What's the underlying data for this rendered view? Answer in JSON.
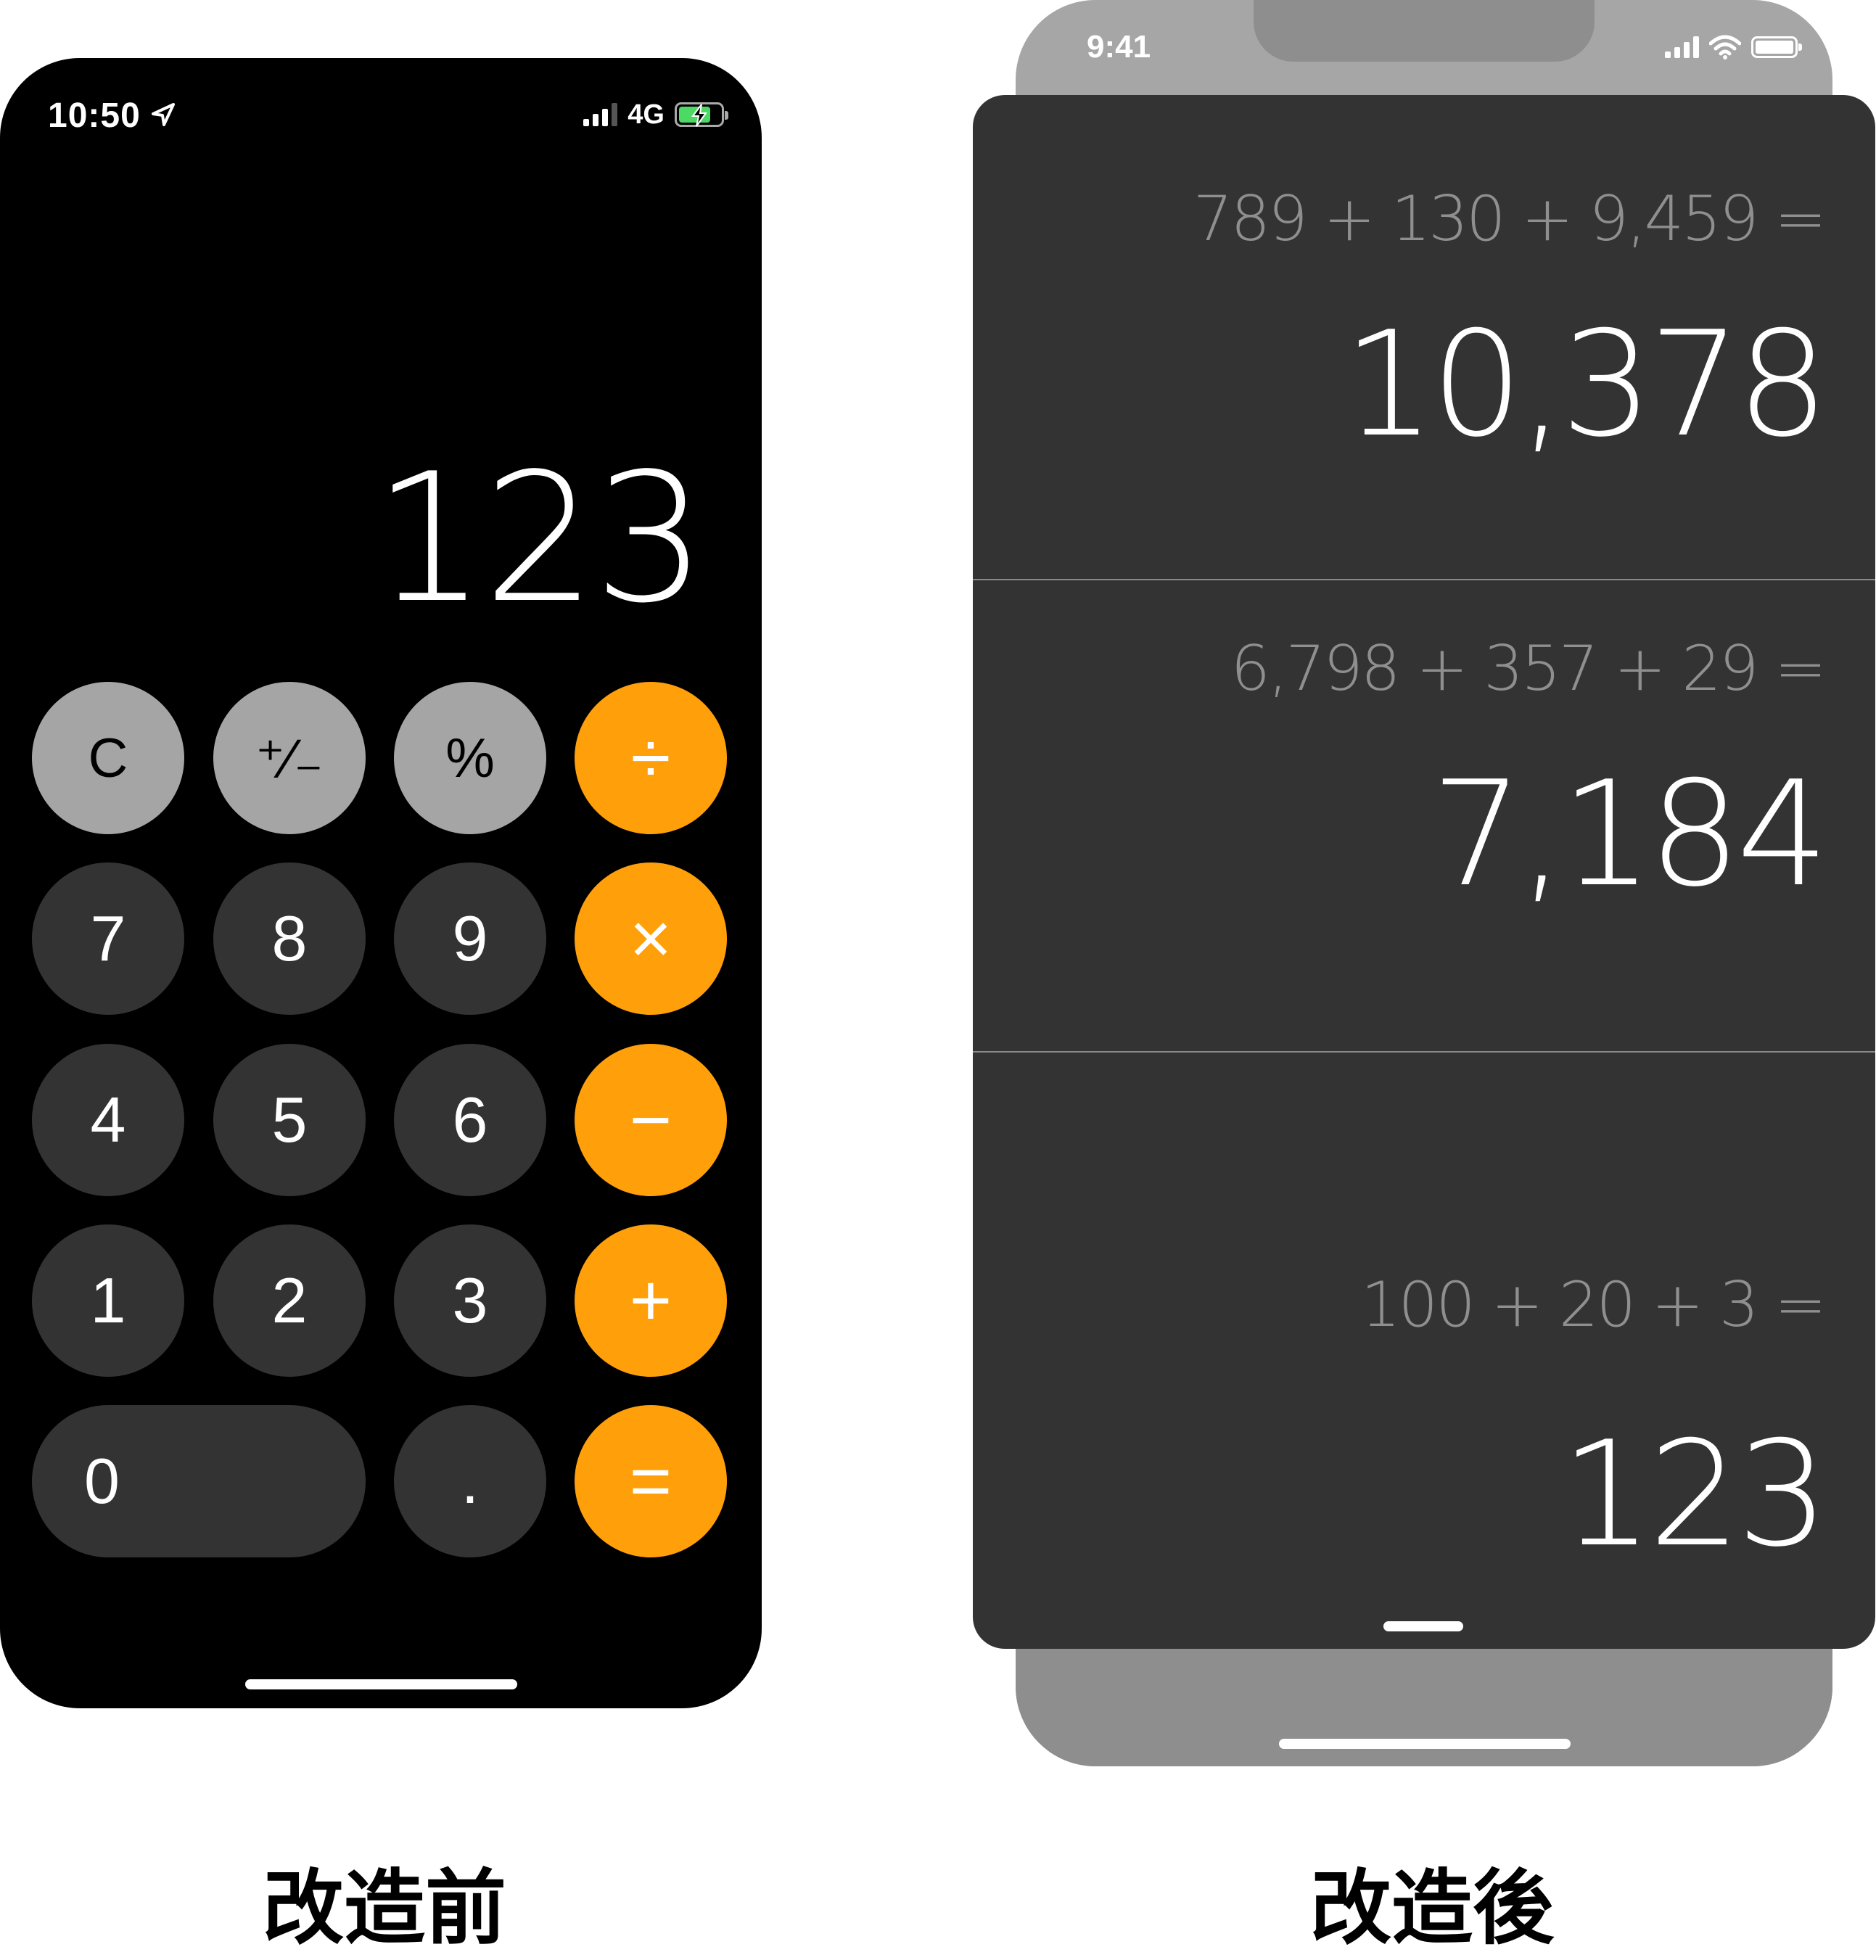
{
  "before": {
    "status_bar": {
      "time": "10:50",
      "network": "4G"
    },
    "display": "123",
    "keys": [
      {
        "label": "C",
        "type": "fn"
      },
      {
        "label": "⁺∕₋",
        "type": "fn"
      },
      {
        "label": "%",
        "type": "fn"
      },
      {
        "label": "÷",
        "type": "op"
      },
      {
        "label": "7",
        "type": "num"
      },
      {
        "label": "8",
        "type": "num"
      },
      {
        "label": "9",
        "type": "num"
      },
      {
        "label": "×",
        "type": "op"
      },
      {
        "label": "4",
        "type": "num"
      },
      {
        "label": "5",
        "type": "num"
      },
      {
        "label": "6",
        "type": "num"
      },
      {
        "label": "−",
        "type": "op"
      },
      {
        "label": "1",
        "type": "num"
      },
      {
        "label": "2",
        "type": "num"
      },
      {
        "label": "3",
        "type": "num"
      },
      {
        "label": "+",
        "type": "op"
      },
      {
        "label": "0",
        "type": "num"
      },
      {
        "label": ".",
        "type": "num"
      },
      {
        "label": "=",
        "type": "op"
      }
    ],
    "caption": "改造前"
  },
  "after": {
    "status_bar": {
      "time": "9:41"
    },
    "history": [
      {
        "expression": "789 + 130 + 9,459 =",
        "result": "10,378"
      },
      {
        "expression": "6,798 + 357 + 29 =",
        "result": "7,184"
      },
      {
        "expression": "100 + 20 + 3 =",
        "result": "123"
      }
    ],
    "caption": "改造後"
  },
  "colors": {
    "operator": "#ff9f0a",
    "function_key": "#a5a5a5",
    "number_key": "#333333",
    "card_background": "#333333",
    "frame_gray": "#a6a6a6"
  },
  "icons": [
    "location-arrow-icon",
    "signal-icon",
    "battery-charging-icon",
    "wifi-icon",
    "battery-icon"
  ]
}
